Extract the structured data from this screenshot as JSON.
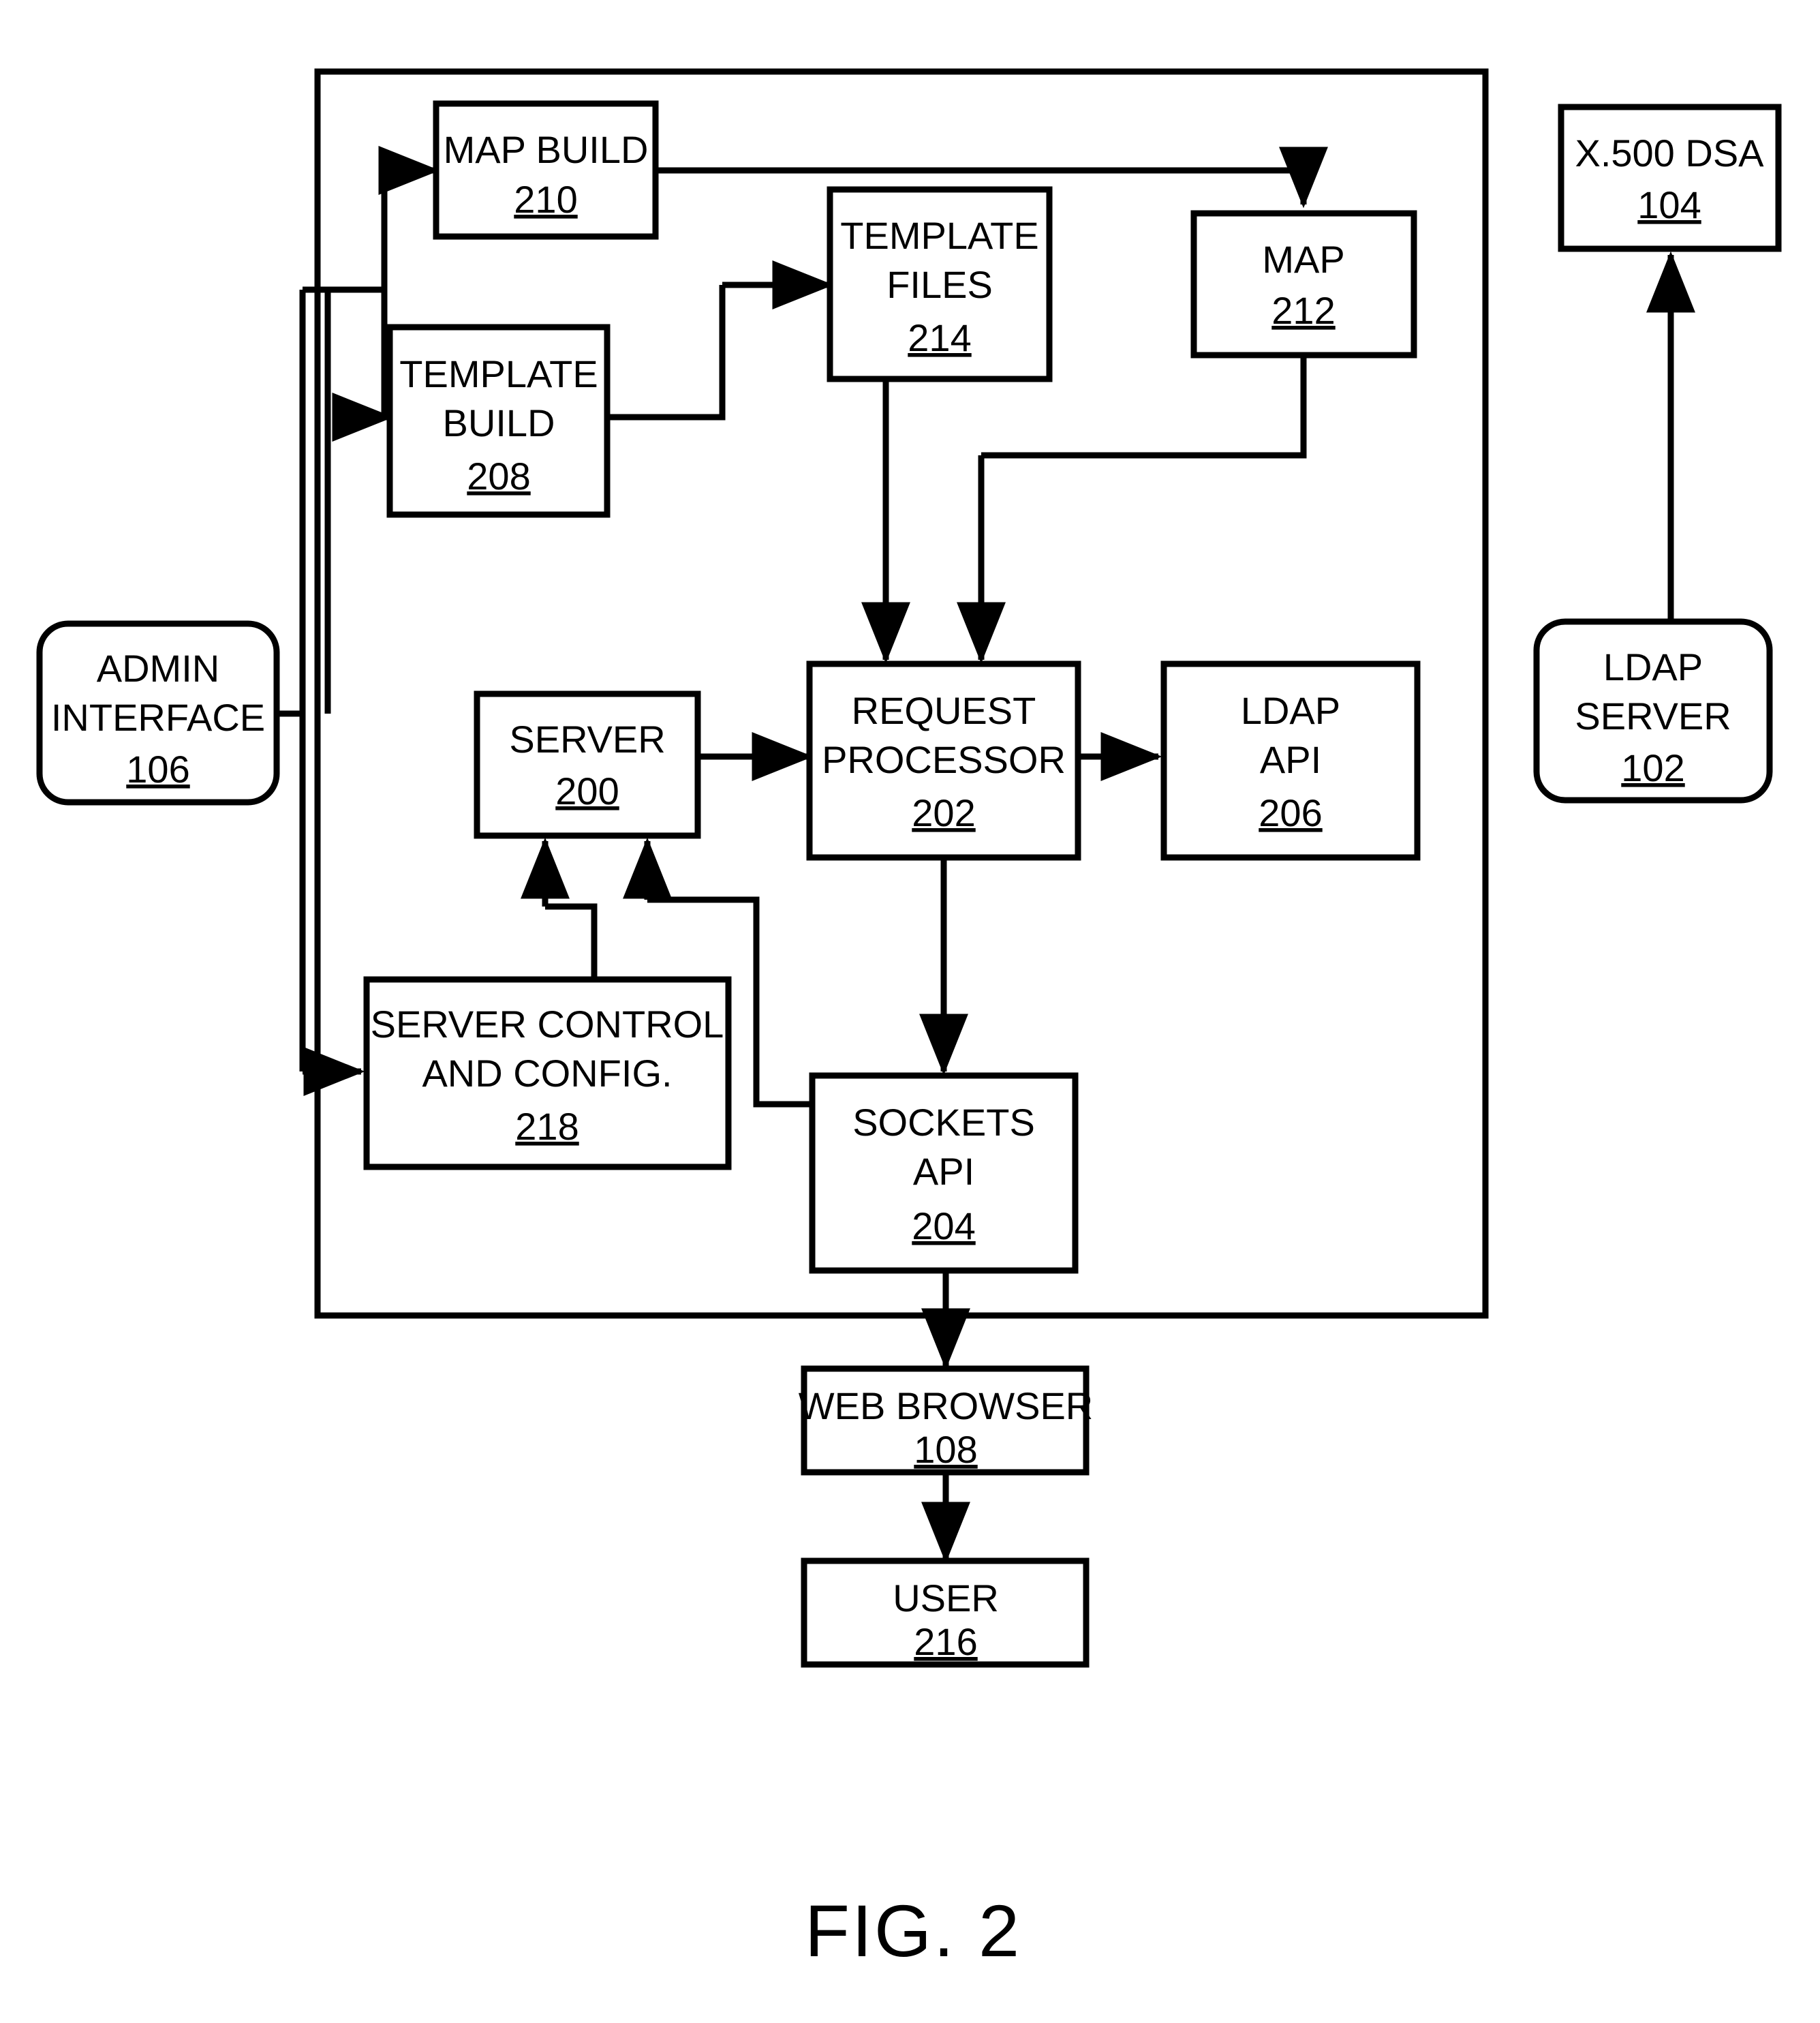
{
  "figure": {
    "caption": "FIG. 2",
    "type": "patent-block-diagram"
  },
  "nodes": {
    "map_build": {
      "label_line1": "MAP BUILD",
      "label_line2": "",
      "ref": "210"
    },
    "template_build": {
      "label_line1": "TEMPLATE",
      "label_line2": "BUILD",
      "ref": "208"
    },
    "template_files": {
      "label_line1": "TEMPLATE",
      "label_line2": "FILES",
      "ref": "214"
    },
    "map": {
      "label_line1": "MAP",
      "label_line2": "",
      "ref": "212"
    },
    "x500_dsa": {
      "label_line1": "X.500 DSA",
      "label_line2": "",
      "ref": "104"
    },
    "admin_interface": {
      "label_line1": "ADMIN",
      "label_line2": "INTERFACE",
      "ref": "106"
    },
    "server": {
      "label_line1": "SERVER",
      "label_line2": "",
      "ref": "200"
    },
    "request_processor": {
      "label_line1": "REQUEST",
      "label_line2": "PROCESSOR",
      "ref": "202"
    },
    "ldap_api": {
      "label_line1": "LDAP",
      "label_line2": "API",
      "ref": "206"
    },
    "ldap_server": {
      "label_line1": "LDAP",
      "label_line2": "SERVER",
      "ref": "102"
    },
    "server_control": {
      "label_line1": "SERVER CONTROL",
      "label_line2": "AND CONFIG.",
      "ref": "218"
    },
    "sockets_api": {
      "label_line1": "SOCKETS",
      "label_line2": "API",
      "ref": "204"
    },
    "web_browser": {
      "label_line1": "WEB BROWSER",
      "label_line2": "",
      "ref": "108"
    },
    "user": {
      "label_line1": "USER",
      "label_line2": "",
      "ref": "216"
    }
  },
  "colors": {
    "stroke": "#000000",
    "fill": "#ffffff",
    "text": "#000000"
  }
}
